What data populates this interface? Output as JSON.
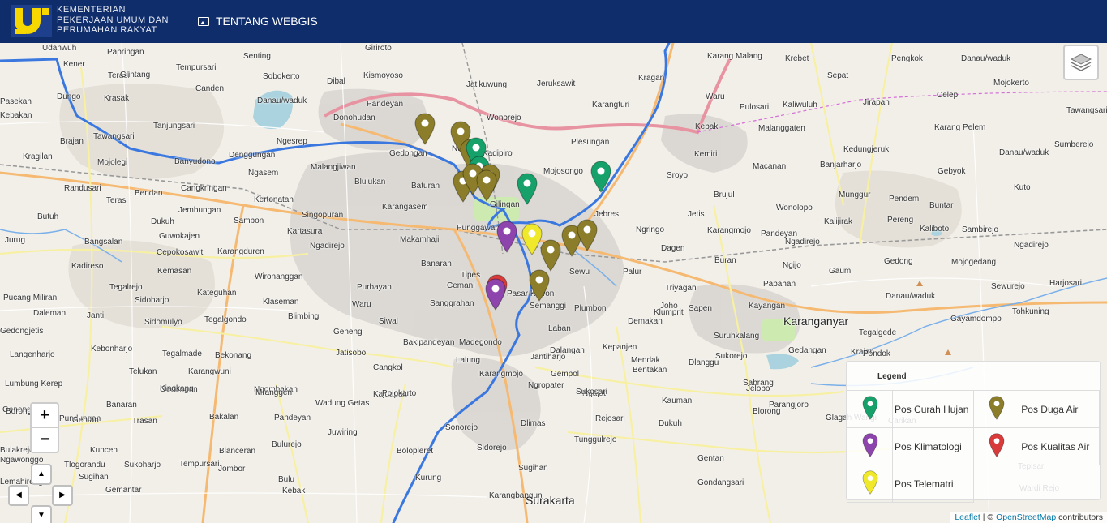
{
  "header": {
    "org_line1": "KEMENTERIAN",
    "org_line2": "PEKERJAAN UMUM DAN",
    "org_line3": "PERUMAHAN RAKYAT",
    "menu_label": "TENTANG WEBGIS",
    "menu_icon": "image-icon"
  },
  "map": {
    "places": [
      {
        "name": "Udanwuh"
      },
      {
        "name": "Papringan"
      },
      {
        "name": "Kener"
      },
      {
        "name": "Terasi"
      },
      {
        "name": "Tempursari"
      },
      {
        "name": "Senting"
      },
      {
        "name": "Giriroto"
      },
      {
        "name": "Sobokerto"
      },
      {
        "name": "Kismoyoso"
      },
      {
        "name": "Dibal"
      },
      {
        "name": "Jatikuwung"
      },
      {
        "name": "Jeruksawit"
      },
      {
        "name": "Kragan"
      },
      {
        "name": "Karang Malang"
      },
      {
        "name": "Krebet"
      },
      {
        "name": "Sepat"
      },
      {
        "name": "Pengkok"
      },
      {
        "name": "Danau/waduk"
      },
      {
        "name": "Mojokerto"
      },
      {
        "name": "Pasekan"
      },
      {
        "name": "Dungo"
      },
      {
        "name": "Krasak"
      },
      {
        "name": "Glintang"
      },
      {
        "name": "Canden"
      },
      {
        "name": "Pandeyan"
      },
      {
        "name": "Wonorejo"
      },
      {
        "name": "Karangturi"
      },
      {
        "name": "Waru"
      },
      {
        "name": "Pulosari"
      },
      {
        "name": "Kaliwuluh"
      },
      {
        "name": "Jirapan"
      },
      {
        "name": "Celep"
      },
      {
        "name": "Tawangsari"
      },
      {
        "name": "Kebakan"
      },
      {
        "name": "Tanjungsari"
      },
      {
        "name": "Danau/waduk"
      },
      {
        "name": "Donohudan"
      },
      {
        "name": "Kebak"
      },
      {
        "name": "Malanggaten"
      },
      {
        "name": "Karang Pelem"
      },
      {
        "name": "Kragilan"
      },
      {
        "name": "Brajan"
      },
      {
        "name": "Tawangsari"
      },
      {
        "name": "Banyudono"
      },
      {
        "name": "Ngesrep"
      },
      {
        "name": "Gedongan"
      },
      {
        "name": "Nusukan"
      },
      {
        "name": "Plesungan"
      },
      {
        "name": "Kemiri"
      },
      {
        "name": "Kedungjeruk"
      },
      {
        "name": "Danau/waduk"
      },
      {
        "name": "Sumberejo"
      },
      {
        "name": "Mojolegi"
      },
      {
        "name": "Denggungan"
      },
      {
        "name": "Ngasem"
      },
      {
        "name": "Malangjiwan"
      },
      {
        "name": "Blulukan"
      },
      {
        "name": "Baturan"
      },
      {
        "name": "Kadipiro"
      },
      {
        "name": "Mojosongo"
      },
      {
        "name": "Sroyo"
      },
      {
        "name": "Macanan"
      },
      {
        "name": "Banjarharjo"
      },
      {
        "name": "Gebyok"
      },
      {
        "name": "Randusari"
      },
      {
        "name": "Teras"
      },
      {
        "name": "Bendan"
      },
      {
        "name": "Cangkringan"
      },
      {
        "name": "Kertonatan"
      },
      {
        "name": "Karangasem"
      },
      {
        "name": "Gilingan"
      },
      {
        "name": "Brujul"
      },
      {
        "name": "Munggur"
      },
      {
        "name": "Pendem"
      },
      {
        "name": "Kuto"
      },
      {
        "name": "Butuh"
      },
      {
        "name": "Dukuh"
      },
      {
        "name": "Jembungan"
      },
      {
        "name": "Sambon"
      },
      {
        "name": "Singopuran"
      },
      {
        "name": "Jebres"
      },
      {
        "name": "Ngringo"
      },
      {
        "name": "Jetis"
      },
      {
        "name": "Wonolopo"
      },
      {
        "name": "Buntar"
      },
      {
        "name": "Jurug"
      },
      {
        "name": "Bangsalan"
      },
      {
        "name": "Guwokajen"
      },
      {
        "name": "Kartasura"
      },
      {
        "name": "Makamhaji"
      },
      {
        "name": "Punggawan"
      },
      {
        "name": "Karangmojo"
      },
      {
        "name": "Kalijirak"
      },
      {
        "name": "Pereng"
      },
      {
        "name": "Kaliboto"
      },
      {
        "name": "Sambirejo"
      },
      {
        "name": "Ngadirejo"
      },
      {
        "name": "Ngadirejo"
      },
      {
        "name": "Kadireso"
      },
      {
        "name": "Cepokosawit"
      },
      {
        "name": "Karangduren"
      },
      {
        "name": "Dagen"
      },
      {
        "name": "Pandeyan"
      },
      {
        "name": "Ngadirejo"
      },
      {
        "name": "Banaran"
      },
      {
        "name": "Kemasan"
      },
      {
        "name": "Wironanggan"
      },
      {
        "name": "Buran"
      },
      {
        "name": "Ngijo"
      },
      {
        "name": "Gedong"
      },
      {
        "name": "Mojogedang"
      },
      {
        "name": "Tegalrejo"
      },
      {
        "name": "Tipes"
      },
      {
        "name": "Sewu"
      },
      {
        "name": "Palur"
      },
      {
        "name": "Gaum"
      },
      {
        "name": "Purbayan"
      },
      {
        "name": "Cemani"
      },
      {
        "name": "Pasar Kliwon"
      },
      {
        "name": "Triyagan"
      },
      {
        "name": "Papahan"
      },
      {
        "name": "Sewurejo"
      },
      {
        "name": "Harjosari"
      },
      {
        "name": "Pucang Miliran"
      },
      {
        "name": "Sidoharjo"
      },
      {
        "name": "Kateguhan"
      },
      {
        "name": "Klaseman"
      },
      {
        "name": "Sanggrahan"
      },
      {
        "name": "Semanggi"
      },
      {
        "name": "Plumbon"
      },
      {
        "name": "Joho"
      },
      {
        "name": "Sapen"
      },
      {
        "name": "Kayangan"
      },
      {
        "name": "Danau/waduk"
      },
      {
        "name": "Daleman"
      },
      {
        "name": "Janti"
      },
      {
        "name": "Blimbing"
      },
      {
        "name": "Waru"
      },
      {
        "name": "Tohkuning"
      },
      {
        "name": "Sidomulyo"
      },
      {
        "name": "Tegalgondo"
      },
      {
        "name": "Siwal"
      },
      {
        "name": "Demakan"
      },
      {
        "name": "Karanganyar"
      },
      {
        "name": "Gedongjetis"
      },
      {
        "name": "Geneng"
      },
      {
        "name": "Laban"
      },
      {
        "name": "Klumprit"
      },
      {
        "name": "Suruhkalang"
      },
      {
        "name": "Tegalgede"
      },
      {
        "name": "Gayamdompo"
      },
      {
        "name": "Kebonharjo"
      },
      {
        "name": "Bakipandeyan"
      },
      {
        "name": "Madegondo"
      },
      {
        "name": "Dalangan"
      },
      {
        "name": "Kepanjen"
      },
      {
        "name": "Sukorejo"
      },
      {
        "name": "Krajan"
      },
      {
        "name": "Langenharjo"
      },
      {
        "name": "Tegalmade"
      },
      {
        "name": "Bekonang"
      },
      {
        "name": "Jatisobo"
      },
      {
        "name": "Lalung"
      },
      {
        "name": "Jantiharjo"
      },
      {
        "name": "Mendak"
      },
      {
        "name": "Dlanggu"
      },
      {
        "name": "Gedangan"
      },
      {
        "name": "Pondok"
      },
      {
        "name": "Telukan"
      },
      {
        "name": "Karangwuni"
      },
      {
        "name": "Cangkol"
      },
      {
        "name": "Karangmojo"
      },
      {
        "name": "Gempol"
      },
      {
        "name": "Bentakan"
      },
      {
        "name": "Sabrang"
      },
      {
        "name": "Lumbung Kerep"
      },
      {
        "name": "Gedongan"
      },
      {
        "name": "Ngombakan"
      },
      {
        "name": "Kajuapak"
      },
      {
        "name": "Ngropater"
      },
      {
        "name": "Ngajat"
      },
      {
        "name": "Kauman"
      },
      {
        "name": "Jelobo"
      },
      {
        "name": "Genengsari"
      },
      {
        "name": "Pundungan"
      },
      {
        "name": "Kingkang"
      },
      {
        "name": "Mranggen"
      },
      {
        "name": "Polokarto"
      },
      {
        "name": "Sukosari"
      },
      {
        "name": "Blorong"
      },
      {
        "name": "Borongan"
      },
      {
        "name": "Banaran"
      },
      {
        "name": "Wadung Getas"
      },
      {
        "name": "Parangjoro"
      },
      {
        "name": "Bakalan"
      },
      {
        "name": "Pandeyan"
      },
      {
        "name": "Glagah Wangi"
      },
      {
        "name": "Carikan"
      },
      {
        "name": "Bulakrejo"
      },
      {
        "name": "Gentan"
      },
      {
        "name": "Trasan"
      },
      {
        "name": "Juwiring"
      },
      {
        "name": "Sonorejo"
      },
      {
        "name": "Rejosari"
      },
      {
        "name": "Dlimas"
      },
      {
        "name": "Kuncen"
      },
      {
        "name": "Bulurejo"
      },
      {
        "name": "Sidorejo"
      },
      {
        "name": "Tunggulrejo"
      },
      {
        "name": "Tempursari"
      },
      {
        "name": "Blanceran"
      },
      {
        "name": "Bolopleret"
      },
      {
        "name": "Dukuh"
      },
      {
        "name": "Tepisari"
      },
      {
        "name": "Ngawonggo"
      },
      {
        "name": "Tlogorandu"
      },
      {
        "name": "Sukoharjo"
      },
      {
        "name": "Jombor"
      },
      {
        "name": "Sugihan"
      },
      {
        "name": "Gentan"
      },
      {
        "name": "Wardi Rejo"
      },
      {
        "name": "Lemahireng"
      },
      {
        "name": "Sugihan"
      },
      {
        "name": "Bulu"
      },
      {
        "name": "Kurung"
      },
      {
        "name": "Gondangsari"
      },
      {
        "name": "Gemantar"
      },
      {
        "name": "Kebak"
      },
      {
        "name": "Karangbangun"
      },
      {
        "name": "Surakarta"
      }
    ],
    "markers": [
      {
        "type": "duga_air",
        "color": "#8b7d2a"
      },
      {
        "type": "duga_air",
        "color": "#8b7d2a"
      },
      {
        "type": "duga_air",
        "color": "#8b7d2a"
      },
      {
        "type": "curah_hujan",
        "color": "#16a06a"
      },
      {
        "type": "curah_hujan",
        "color": "#16a06a"
      },
      {
        "type": "duga_air",
        "color": "#8b7d2a"
      },
      {
        "type": "duga_air",
        "color": "#8b7d2a"
      },
      {
        "type": "duga_air",
        "color": "#8b7d2a"
      },
      {
        "type": "duga_air",
        "color": "#8b7d2a"
      },
      {
        "type": "curah_hujan",
        "color": "#16a06a"
      },
      {
        "type": "curah_hujan",
        "color": "#16a06a"
      },
      {
        "type": "klimatologi",
        "color": "#8e44ad"
      },
      {
        "type": "telematri",
        "color": "#f0e82a"
      },
      {
        "type": "duga_air",
        "color": "#8b7d2a"
      },
      {
        "type": "duga_air",
        "color": "#8b7d2a"
      },
      {
        "type": "duga_air",
        "color": "#8b7d2a"
      },
      {
        "type": "duga_air",
        "color": "#8b7d2a"
      },
      {
        "type": "kualitas_air",
        "color": "#d93b3b"
      },
      {
        "type": "klimatologi",
        "color": "#8e44ad"
      }
    ],
    "layers_icon": "layers-icon",
    "zoom_in": "+",
    "zoom_out": "−",
    "pan_up": "▲",
    "pan_down": "▼",
    "pan_left": "◀",
    "pan_right": "▶"
  },
  "legend": {
    "title": "Legend",
    "items": [
      {
        "label": "Pos Curah Hujan",
        "color": "#16a06a"
      },
      {
        "label": "Pos Duga Air",
        "color": "#8b7d2a"
      },
      {
        "label": "Pos Klimatologi",
        "color": "#8e44ad"
      },
      {
        "label": "Pos Kualitas Air",
        "color": "#d93b3b"
      },
      {
        "label": "Pos Telematri",
        "color": "#f0e82a"
      }
    ]
  },
  "attribution": {
    "leaflet": "Leaflet",
    "separator": " | © ",
    "osm": "OpenStreetMap",
    "suffix": " contributors"
  }
}
